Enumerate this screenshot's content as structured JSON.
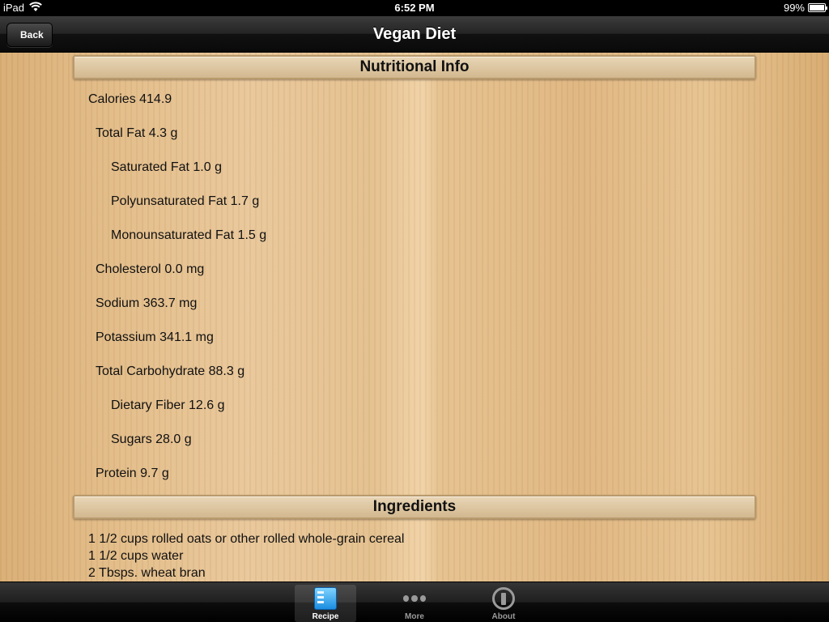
{
  "status_bar": {
    "carrier": "iPad",
    "time": "6:52 PM",
    "battery_percent": "99%",
    "battery_level": 0.99
  },
  "nav": {
    "title": "Vegan Diet",
    "back_label": "Back"
  },
  "nutrition": {
    "header": "Nutritional Info",
    "items": [
      {
        "text": "Calories 414.9",
        "level": 0
      },
      {
        "text": "Total Fat 4.3 g",
        "level": 1
      },
      {
        "text": "Saturated Fat 1.0 g",
        "level": 2
      },
      {
        "text": "Polyunsaturated Fat 1.7 g",
        "level": 2
      },
      {
        "text": "Monounsaturated Fat 1.5 g",
        "level": 2
      },
      {
        "text": "Cholesterol 0.0 mg",
        "level": 1
      },
      {
        "text": "Sodium 363.7 mg",
        "level": 1
      },
      {
        "text": "Potassium 341.1 mg",
        "level": 1
      },
      {
        "text": "Total Carbohydrate 88.3 g",
        "level": 1
      },
      {
        "text": "Dietary Fiber 12.6 g",
        "level": 2
      },
      {
        "text": "Sugars 28.0 g",
        "level": 2
      },
      {
        "text": "Protein 9.7 g",
        "level": 1
      }
    ]
  },
  "ingredients": {
    "header": "Ingredients",
    "items": [
      "1 1/2 cups rolled oats or other rolled whole-grain cereal",
      "1 1/2 cups water",
      "2 Tbsps. wheat bran"
    ]
  },
  "tab_bar": {
    "tabs": [
      {
        "label": "Recipe",
        "icon": "recipe-icon",
        "selected": true
      },
      {
        "label": "More",
        "icon": "more-icon",
        "selected": false
      },
      {
        "label": "About",
        "icon": "info-icon",
        "selected": false
      }
    ]
  }
}
